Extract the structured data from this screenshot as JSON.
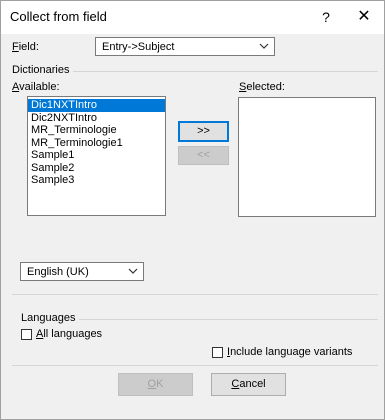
{
  "window": {
    "title": "Collect from field",
    "help_glyph": "?",
    "close_glyph": "✕"
  },
  "field": {
    "label_u": "F",
    "label_rest": "ield:",
    "value": "Entry->Subject"
  },
  "dictionaries": {
    "group_label": "Dictionaries",
    "available_label_u": "A",
    "available_label_rest": "vailable:",
    "selected_label_u": "S",
    "selected_label_rest": "elected:",
    "available_items": [
      "Dic1NXTIntro",
      "Dic2NXTIntro",
      "MR_Terminologie",
      "MR_Terminologie1",
      "Sample1",
      "Sample2",
      "Sample3"
    ],
    "selected_index": 0,
    "selected_items": [],
    "add_button": ">>",
    "remove_button": "<<",
    "language_value": "English (UK)"
  },
  "languages": {
    "group_label": "Languages",
    "all_languages_u": "A",
    "all_languages_rest": "ll languages",
    "all_languages_checked": false,
    "include_variants_u": "I",
    "include_variants_rest": "nclude language variants",
    "include_variants_checked": false
  },
  "buttons": {
    "ok_u": "O",
    "ok_rest": "K",
    "cancel_u": "C",
    "cancel_rest": "ancel"
  },
  "colors": {
    "selection": "#0078d7",
    "focus_border": "#0078d7"
  },
  "icons": {
    "dropdown": "chevron-down-icon",
    "close": "close-icon",
    "help": "help-icon"
  }
}
